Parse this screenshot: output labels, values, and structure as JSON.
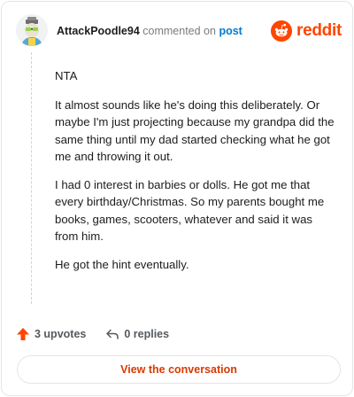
{
  "comment": {
    "author": "AttackPoodle94",
    "action_text": "commented on",
    "post_link": "post",
    "paragraphs": [
      "NTA",
      "It almost sounds like he's doing this deliberately. Or maybe I'm just projecting because my grandpa did the same thing until my dad started checking what he got me and throwing it out.",
      "I had 0 interest in barbies or dolls. He got me that every birthday/Christmas. So my parents bought me books, games, scooters, whatever and said it was from him.",
      "He got the hint eventually."
    ]
  },
  "brand": {
    "name": "reddit",
    "color": "#ff4500"
  },
  "footer": {
    "upvotes_label": "3 upvotes",
    "replies_label": "0 replies",
    "view_button": "View the conversation"
  },
  "icons": {
    "avatar": "avatar-image",
    "logo": "reddit-logo-icon",
    "upvote": "upvote-arrow-icon",
    "reply": "reply-arrow-icon"
  }
}
